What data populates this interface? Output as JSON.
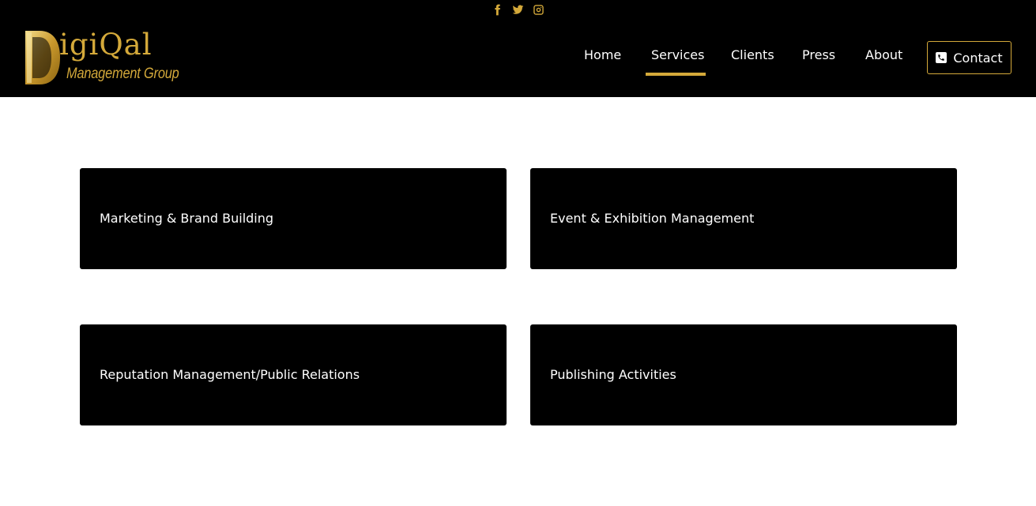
{
  "colors": {
    "accent": "#d4a93a",
    "header_bg": "#000000",
    "card_bg": "#000000",
    "page_bg": "#ffffff"
  },
  "social": [
    {
      "icon": "facebook-icon"
    },
    {
      "icon": "twitter-icon"
    },
    {
      "icon": "instagram-icon"
    }
  ],
  "logo": {
    "word": "igiQal",
    "subtitle": "Management Group"
  },
  "nav": {
    "items": [
      "Home",
      "Services",
      "Clients",
      "Press",
      "About"
    ],
    "active": "Services",
    "contact_label": "Contact",
    "contact_icon": "phone-icon"
  },
  "services": [
    {
      "label": "Marketing & Brand Building"
    },
    {
      "label": "Event & Exhibition Management"
    },
    {
      "label": "Reputation Management/Public Relations"
    },
    {
      "label": "Publishing Activities"
    }
  ]
}
